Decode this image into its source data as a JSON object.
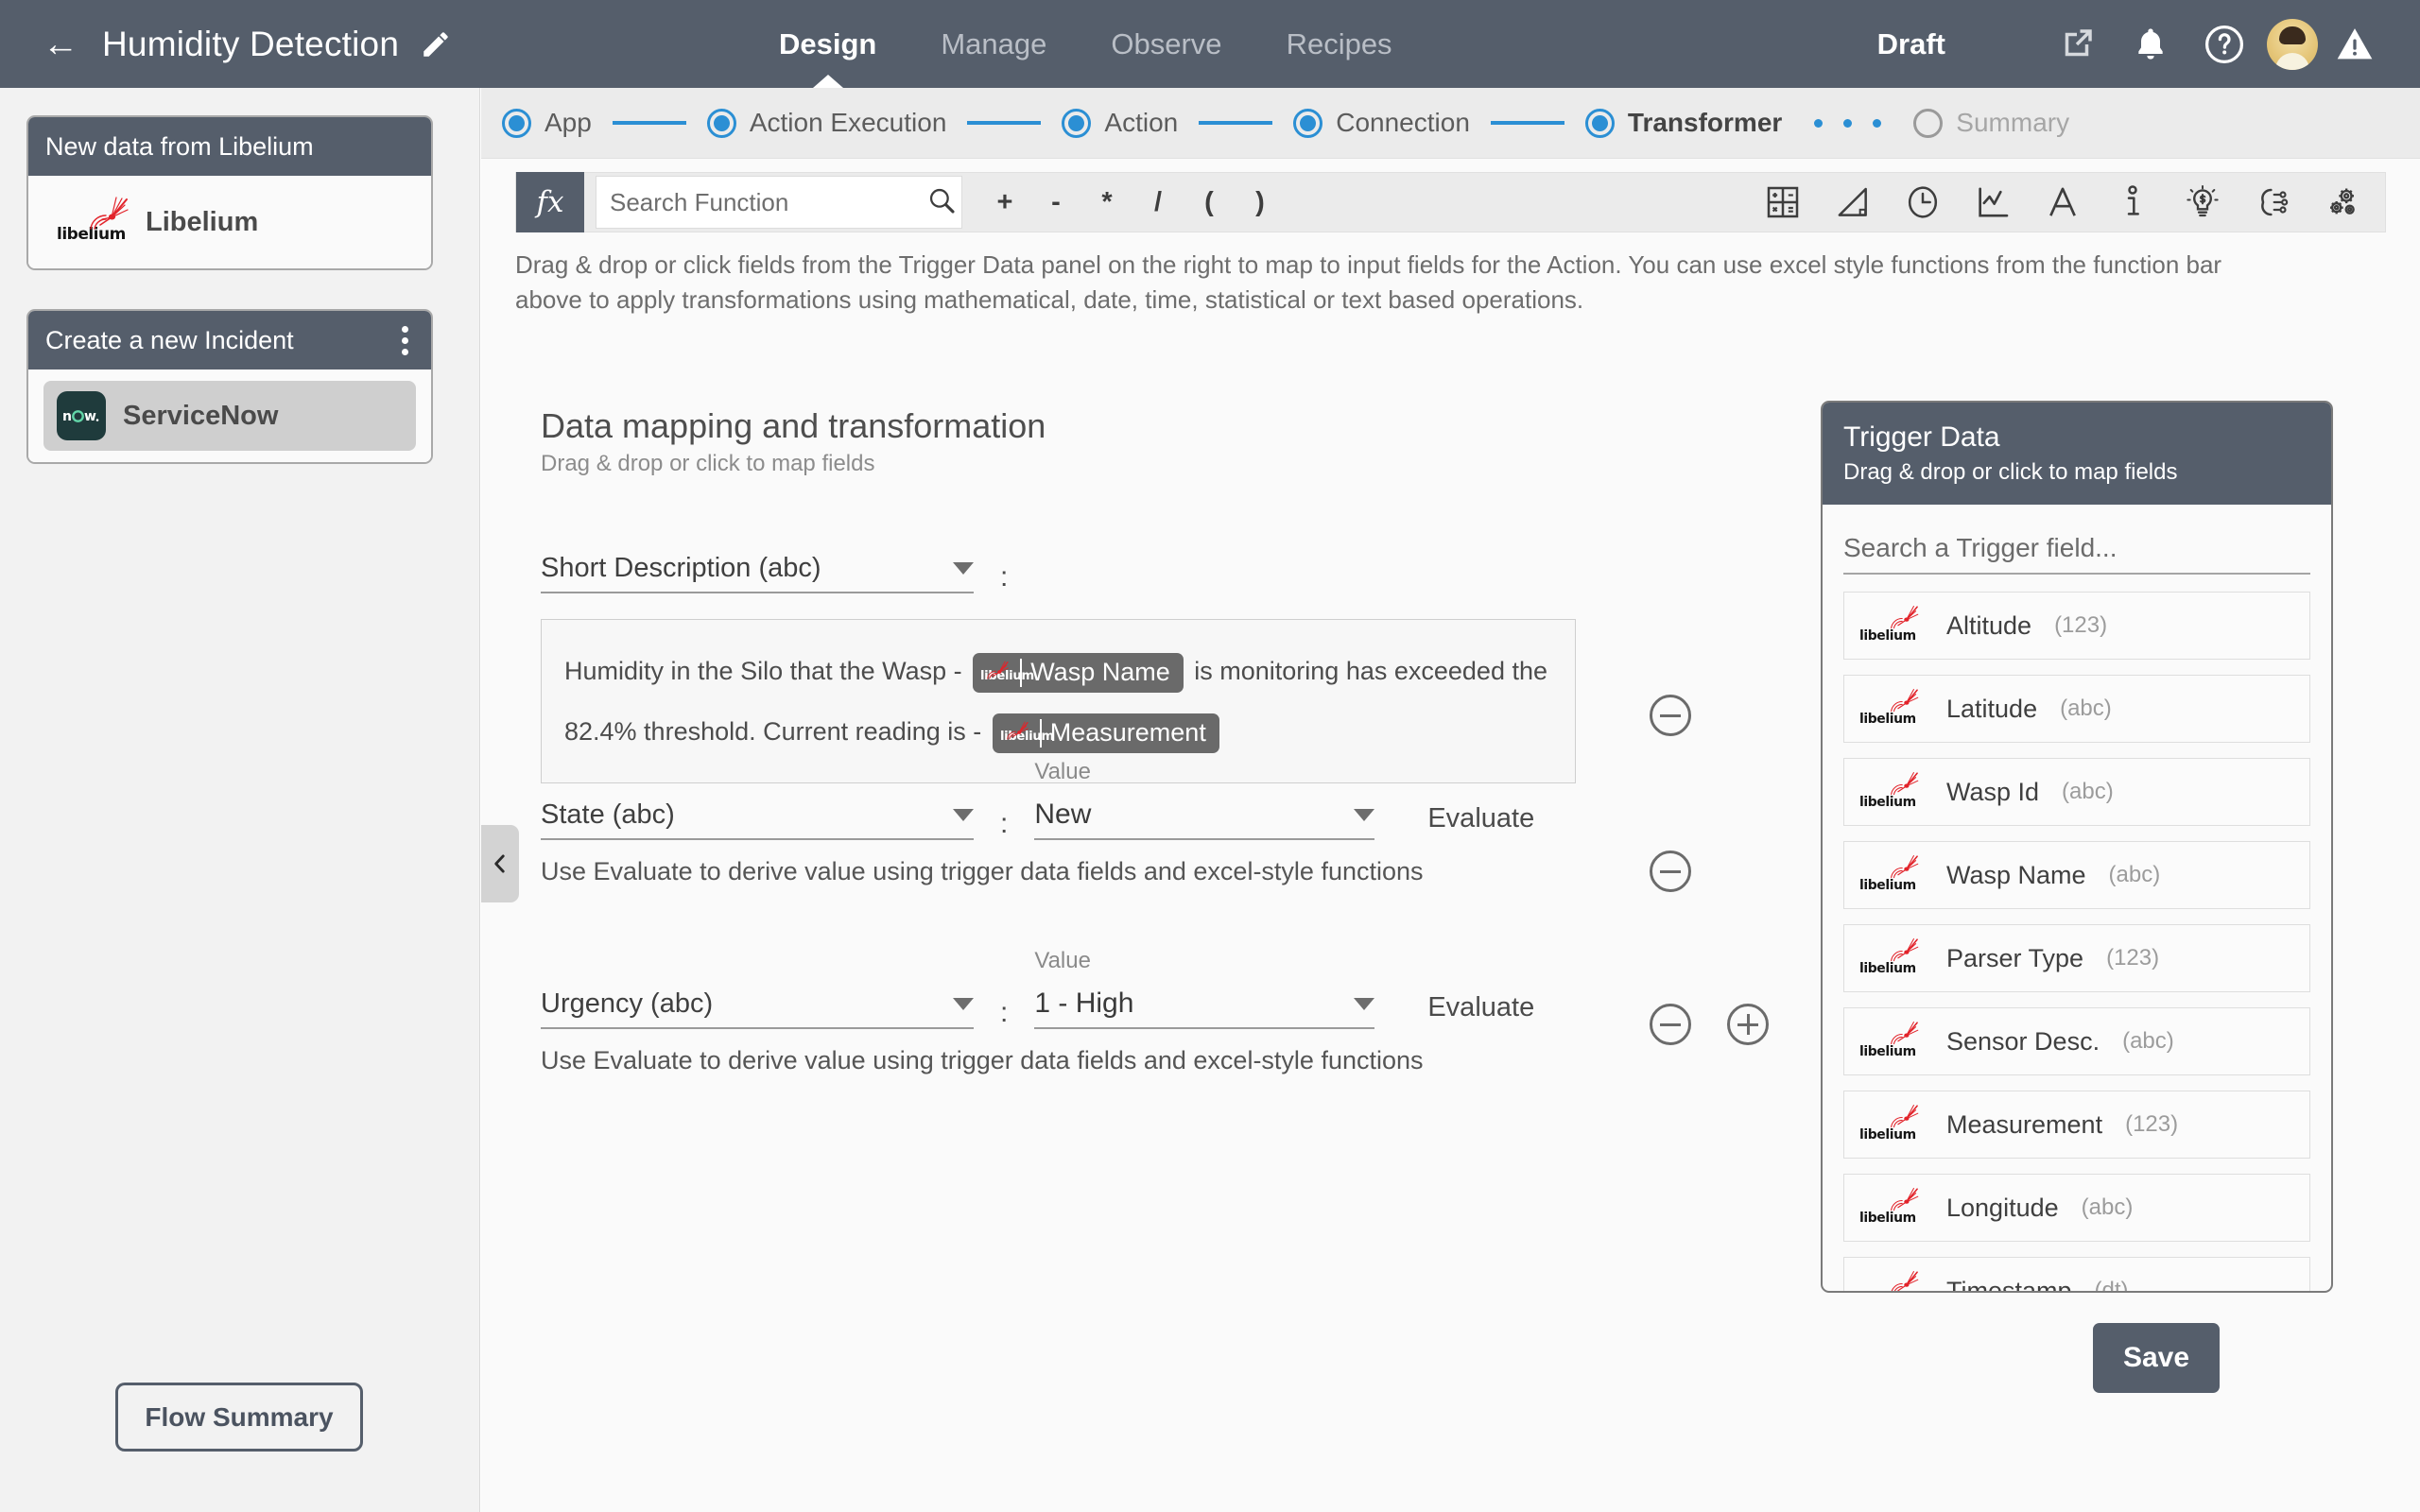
{
  "topbar": {
    "back_icon": "back-arrow-icon",
    "title": "Humidity Detection",
    "edit_icon": "pencil-icon",
    "nav": [
      {
        "label": "Design",
        "active": true
      },
      {
        "label": "Manage",
        "active": false
      },
      {
        "label": "Observe",
        "active": false
      },
      {
        "label": "Recipes",
        "active": false
      }
    ],
    "status": "Draft",
    "icons": [
      "external-link-icon",
      "bell-icon",
      "help-circle-icon",
      "avatar",
      "warning-triangle-icon"
    ]
  },
  "sidebar": {
    "trigger_card": {
      "title": "New data from Libelium",
      "app": "Libelium"
    },
    "chevron_icon": "double-chevron-down-icon",
    "action_card": {
      "title": "Create a new Incident",
      "menu_icon": "kebab-menu-icon",
      "app": "ServiceNow"
    },
    "flow_summary": "Flow Summary"
  },
  "steps": [
    {
      "label": "App",
      "state": "done"
    },
    {
      "label": "Action Execution",
      "state": "done"
    },
    {
      "label": "Action",
      "state": "done"
    },
    {
      "label": "Connection",
      "state": "done"
    },
    {
      "label": "Transformer",
      "state": "current"
    },
    {
      "label": "Summary",
      "state": "pending"
    }
  ],
  "functionbar": {
    "fx_label": "fx",
    "search_placeholder": "Search Function",
    "search_value": "",
    "search_icon": "search-icon",
    "operators": [
      "+",
      "-",
      "*",
      "/",
      "(",
      ")"
    ],
    "category_icons": [
      "calculator-icon",
      "trigonometry-icon",
      "clock-icon",
      "chart-line-icon",
      "text-a-icon",
      "info-icon",
      "lightbulb-dollar-icon",
      "ai-brain-icon",
      "gears-icon"
    ]
  },
  "help_text": "Drag & drop or click fields from the Trigger Data panel on the right to map to input fields for the Action. You can use excel style functions from the function bar above to apply transformations using mathematical, date, time, statistical or text based operations.",
  "section": {
    "title": "Data mapping and transformation",
    "subtitle": "Drag & drop or click to map fields"
  },
  "mapping": {
    "row1": {
      "field": "Short Description (abc)",
      "separator": ":",
      "text_part1": "Humidity in the Silo that the Wasp -",
      "token1": "Wasp Name",
      "text_part2": "is monitoring has exceeded the 82.4% threshold. Current reading is -",
      "token2": "Measurement",
      "remove_icon": "remove-circle-icon"
    },
    "row2": {
      "field": "State (abc)",
      "separator": ":",
      "value_label": "Value",
      "value": "New",
      "evaluate": "Evaluate",
      "hint": "Use Evaluate to derive value using trigger data fields and excel-style functions",
      "remove_icon": "remove-circle-icon"
    },
    "row3": {
      "field": "Urgency (abc)",
      "separator": ":",
      "value_label": "Value",
      "value": "1 - High",
      "evaluate": "Evaluate",
      "hint": "Use Evaluate to derive value using trigger data fields and excel-style functions",
      "remove_icon": "remove-circle-icon",
      "add_icon": "add-circle-icon"
    }
  },
  "collapse_handle_icon": "chevron-left-icon",
  "trigger_panel": {
    "title": "Trigger Data",
    "subtitle": "Drag & drop or click to map fields",
    "search_placeholder": "Search a Trigger field...",
    "search_value": "",
    "fields": [
      {
        "name": "Altitude",
        "type": "(123)"
      },
      {
        "name": "Latitude",
        "type": "(abc)"
      },
      {
        "name": "Wasp Id",
        "type": "(abc)"
      },
      {
        "name": "Wasp Name",
        "type": "(abc)"
      },
      {
        "name": "Parser Type",
        "type": "(123)"
      },
      {
        "name": "Sensor Desc.",
        "type": "(abc)"
      },
      {
        "name": "Measurement",
        "type": "(123)"
      },
      {
        "name": "Longitude",
        "type": "(abc)"
      },
      {
        "name": "Timestamp",
        "type": "(dt)"
      }
    ]
  },
  "save_label": "Save",
  "colors": {
    "header_slate": "#555e6b",
    "accent_blue": "#2b8fd4",
    "libelium_red": "#e2232a",
    "servicenow_teal": "#1f3b3c",
    "panel_bg": "#fafafa"
  }
}
